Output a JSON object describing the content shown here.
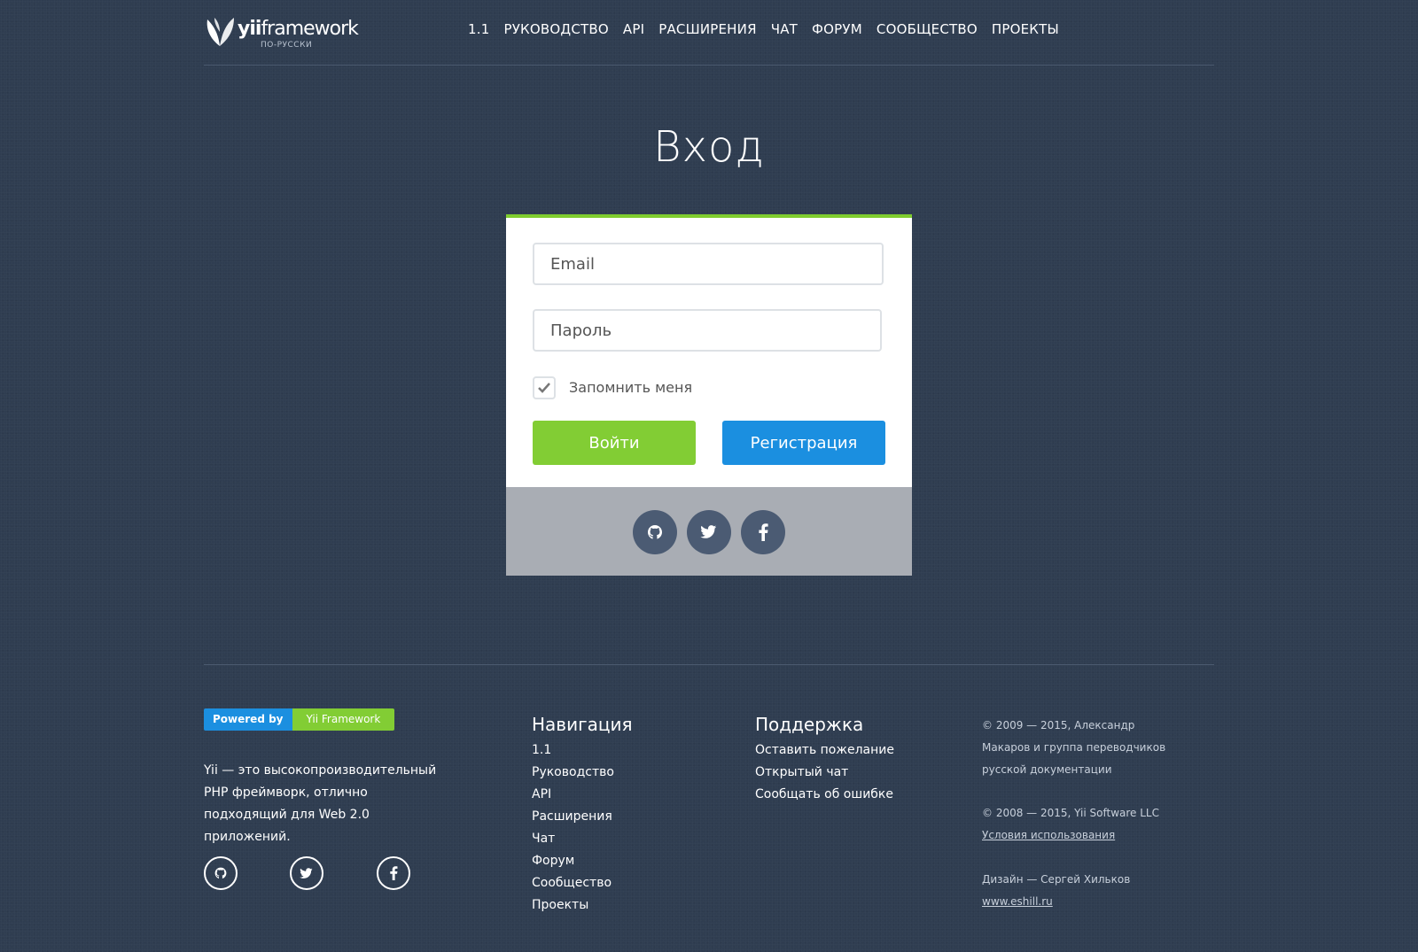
{
  "header": {
    "logo_word_bold": "yii",
    "logo_word": "framework",
    "logo_sub": "ПО-РУССКИ",
    "nav": [
      "1.1",
      "РУКОВОДСТВО",
      "API",
      "РАСШИРЕНИЯ",
      "ЧАТ",
      "ФОРУМ",
      "СООБЩЕСТВО",
      "ПРОЕКТЫ"
    ]
  },
  "title": "Вход",
  "form": {
    "email_placeholder": "Email",
    "password_placeholder": "Пароль",
    "remember_label": "Запомнить меня",
    "remember_checked": true,
    "login_button": "Войти",
    "register_button": "Регистрация",
    "social": [
      "github-icon",
      "twitter-icon",
      "facebook-icon"
    ]
  },
  "footer": {
    "powered_by": "Powered by",
    "powered_name": "Yii Framework",
    "about": "Yii — это высокопроизводительный PHP фреймворк, отлично подходящий для Web 2.0 приложений.",
    "navigation": {
      "title": "Навигация",
      "items": [
        "1.1",
        "Руководство",
        "API",
        "Расширения",
        "Чат",
        "Форум",
        "Сообщество",
        "Проекты"
      ]
    },
    "support": {
      "title": "Поддержка",
      "items": [
        "Оставить пожелание",
        "Открытый чат",
        "Сообщать об ошибке"
      ]
    },
    "copyright1": "© 2009 — 2015, Александр Макаров и группа переводчиков русской документации",
    "copyright2": "© 2008 — 2015, Yii Software LLC",
    "terms_link": "Условия использования",
    "design_credit": "Дизайн — Сергей Хильков",
    "design_link": "www.eshill.ru"
  },
  "colors": {
    "background": "#2f3d51",
    "accent_green": "#82cd34",
    "accent_blue": "#1b8fe0",
    "social_button": "#4b5b73",
    "card_footer": "#a9adb4"
  }
}
